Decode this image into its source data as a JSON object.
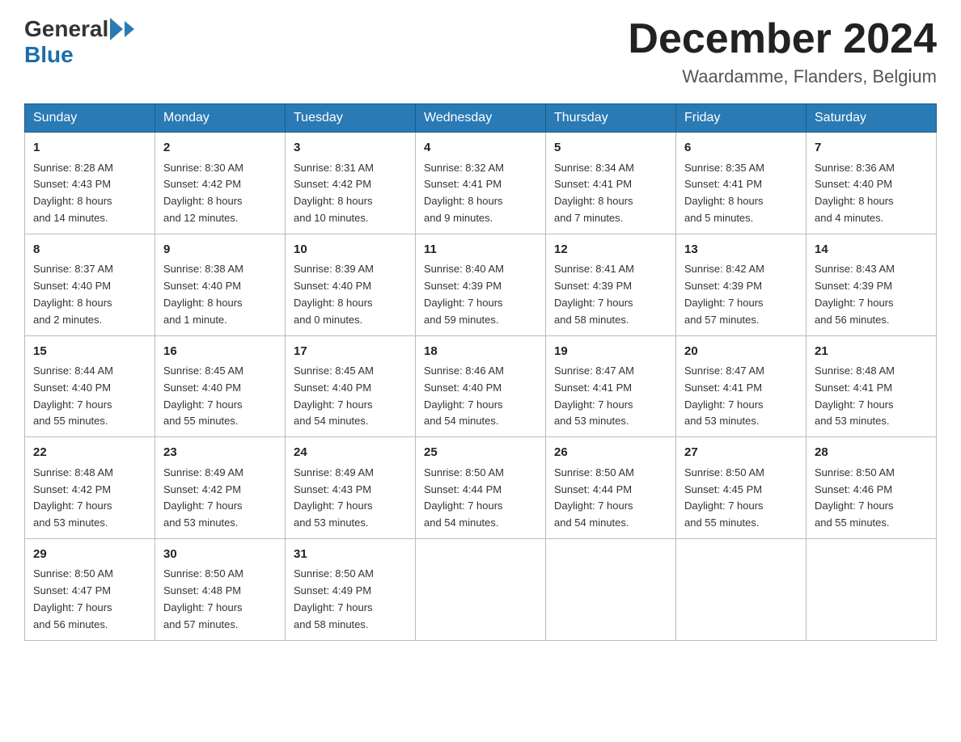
{
  "header": {
    "logo": {
      "general": "General",
      "blue": "Blue"
    },
    "title": "December 2024",
    "location": "Waardamme, Flanders, Belgium"
  },
  "calendar": {
    "days_of_week": [
      "Sunday",
      "Monday",
      "Tuesday",
      "Wednesday",
      "Thursday",
      "Friday",
      "Saturday"
    ],
    "weeks": [
      [
        {
          "day": "1",
          "info": "Sunrise: 8:28 AM\nSunset: 4:43 PM\nDaylight: 8 hours\nand 14 minutes."
        },
        {
          "day": "2",
          "info": "Sunrise: 8:30 AM\nSunset: 4:42 PM\nDaylight: 8 hours\nand 12 minutes."
        },
        {
          "day": "3",
          "info": "Sunrise: 8:31 AM\nSunset: 4:42 PM\nDaylight: 8 hours\nand 10 minutes."
        },
        {
          "day": "4",
          "info": "Sunrise: 8:32 AM\nSunset: 4:41 PM\nDaylight: 8 hours\nand 9 minutes."
        },
        {
          "day": "5",
          "info": "Sunrise: 8:34 AM\nSunset: 4:41 PM\nDaylight: 8 hours\nand 7 minutes."
        },
        {
          "day": "6",
          "info": "Sunrise: 8:35 AM\nSunset: 4:41 PM\nDaylight: 8 hours\nand 5 minutes."
        },
        {
          "day": "7",
          "info": "Sunrise: 8:36 AM\nSunset: 4:40 PM\nDaylight: 8 hours\nand 4 minutes."
        }
      ],
      [
        {
          "day": "8",
          "info": "Sunrise: 8:37 AM\nSunset: 4:40 PM\nDaylight: 8 hours\nand 2 minutes."
        },
        {
          "day": "9",
          "info": "Sunrise: 8:38 AM\nSunset: 4:40 PM\nDaylight: 8 hours\nand 1 minute."
        },
        {
          "day": "10",
          "info": "Sunrise: 8:39 AM\nSunset: 4:40 PM\nDaylight: 8 hours\nand 0 minutes."
        },
        {
          "day": "11",
          "info": "Sunrise: 8:40 AM\nSunset: 4:39 PM\nDaylight: 7 hours\nand 59 minutes."
        },
        {
          "day": "12",
          "info": "Sunrise: 8:41 AM\nSunset: 4:39 PM\nDaylight: 7 hours\nand 58 minutes."
        },
        {
          "day": "13",
          "info": "Sunrise: 8:42 AM\nSunset: 4:39 PM\nDaylight: 7 hours\nand 57 minutes."
        },
        {
          "day": "14",
          "info": "Sunrise: 8:43 AM\nSunset: 4:39 PM\nDaylight: 7 hours\nand 56 minutes."
        }
      ],
      [
        {
          "day": "15",
          "info": "Sunrise: 8:44 AM\nSunset: 4:40 PM\nDaylight: 7 hours\nand 55 minutes."
        },
        {
          "day": "16",
          "info": "Sunrise: 8:45 AM\nSunset: 4:40 PM\nDaylight: 7 hours\nand 55 minutes."
        },
        {
          "day": "17",
          "info": "Sunrise: 8:45 AM\nSunset: 4:40 PM\nDaylight: 7 hours\nand 54 minutes."
        },
        {
          "day": "18",
          "info": "Sunrise: 8:46 AM\nSunset: 4:40 PM\nDaylight: 7 hours\nand 54 minutes."
        },
        {
          "day": "19",
          "info": "Sunrise: 8:47 AM\nSunset: 4:41 PM\nDaylight: 7 hours\nand 53 minutes."
        },
        {
          "day": "20",
          "info": "Sunrise: 8:47 AM\nSunset: 4:41 PM\nDaylight: 7 hours\nand 53 minutes."
        },
        {
          "day": "21",
          "info": "Sunrise: 8:48 AM\nSunset: 4:41 PM\nDaylight: 7 hours\nand 53 minutes."
        }
      ],
      [
        {
          "day": "22",
          "info": "Sunrise: 8:48 AM\nSunset: 4:42 PM\nDaylight: 7 hours\nand 53 minutes."
        },
        {
          "day": "23",
          "info": "Sunrise: 8:49 AM\nSunset: 4:42 PM\nDaylight: 7 hours\nand 53 minutes."
        },
        {
          "day": "24",
          "info": "Sunrise: 8:49 AM\nSunset: 4:43 PM\nDaylight: 7 hours\nand 53 minutes."
        },
        {
          "day": "25",
          "info": "Sunrise: 8:50 AM\nSunset: 4:44 PM\nDaylight: 7 hours\nand 54 minutes."
        },
        {
          "day": "26",
          "info": "Sunrise: 8:50 AM\nSunset: 4:44 PM\nDaylight: 7 hours\nand 54 minutes."
        },
        {
          "day": "27",
          "info": "Sunrise: 8:50 AM\nSunset: 4:45 PM\nDaylight: 7 hours\nand 55 minutes."
        },
        {
          "day": "28",
          "info": "Sunrise: 8:50 AM\nSunset: 4:46 PM\nDaylight: 7 hours\nand 55 minutes."
        }
      ],
      [
        {
          "day": "29",
          "info": "Sunrise: 8:50 AM\nSunset: 4:47 PM\nDaylight: 7 hours\nand 56 minutes."
        },
        {
          "day": "30",
          "info": "Sunrise: 8:50 AM\nSunset: 4:48 PM\nDaylight: 7 hours\nand 57 minutes."
        },
        {
          "day": "31",
          "info": "Sunrise: 8:50 AM\nSunset: 4:49 PM\nDaylight: 7 hours\nand 58 minutes."
        },
        {
          "day": "",
          "info": ""
        },
        {
          "day": "",
          "info": ""
        },
        {
          "day": "",
          "info": ""
        },
        {
          "day": "",
          "info": ""
        }
      ]
    ]
  }
}
